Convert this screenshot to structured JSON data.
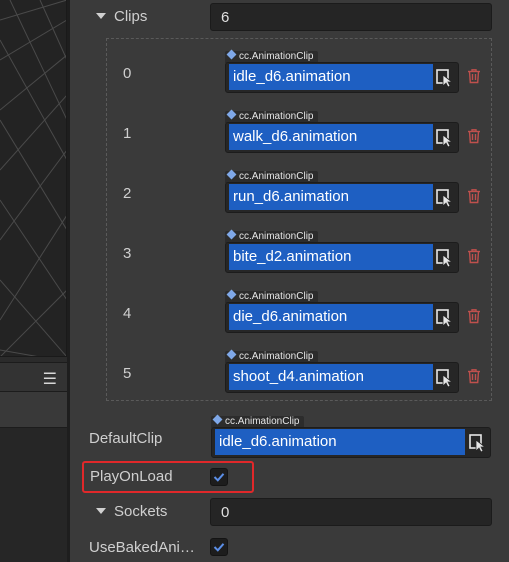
{
  "inspector": {
    "clips": {
      "label": "Clips",
      "count": "6"
    },
    "clip_items": [
      {
        "index": "0",
        "type_tag": "cc.AnimationClip",
        "value": "idle_d6.animation"
      },
      {
        "index": "1",
        "type_tag": "cc.AnimationClip",
        "value": "walk_d6.animation"
      },
      {
        "index": "2",
        "type_tag": "cc.AnimationClip",
        "value": "run_d6.animation"
      },
      {
        "index": "3",
        "type_tag": "cc.AnimationClip",
        "value": "bite_d2.animation"
      },
      {
        "index": "4",
        "type_tag": "cc.AnimationClip",
        "value": "die_d6.animation"
      },
      {
        "index": "5",
        "type_tag": "cc.AnimationClip",
        "value": "shoot_d4.animation"
      }
    ],
    "default_clip": {
      "label": "DefaultClip",
      "type_tag": "cc.AnimationClip",
      "value": "idle_d6.animation"
    },
    "play_on_load": {
      "label": "PlayOnLoad",
      "checked": true
    },
    "sockets": {
      "label": "Sockets",
      "count": "0"
    },
    "use_baked": {
      "label": "UseBakedAni…",
      "checked": true
    }
  },
  "hierarchy": {
    "menu_icon": "hamburger-menu-icon"
  },
  "colors": {
    "accent_blue": "#1e5fc2",
    "highlight_red": "#e0282a",
    "trash_red": "#c0504d",
    "checkbox_blue": "#5b8ee6"
  },
  "icons": {
    "asset_pick": "asset-picker-icon",
    "remove": "trash-icon",
    "checkmark": "checkmark-icon",
    "expand": "caret-down-icon",
    "type": "diamond-icon"
  }
}
